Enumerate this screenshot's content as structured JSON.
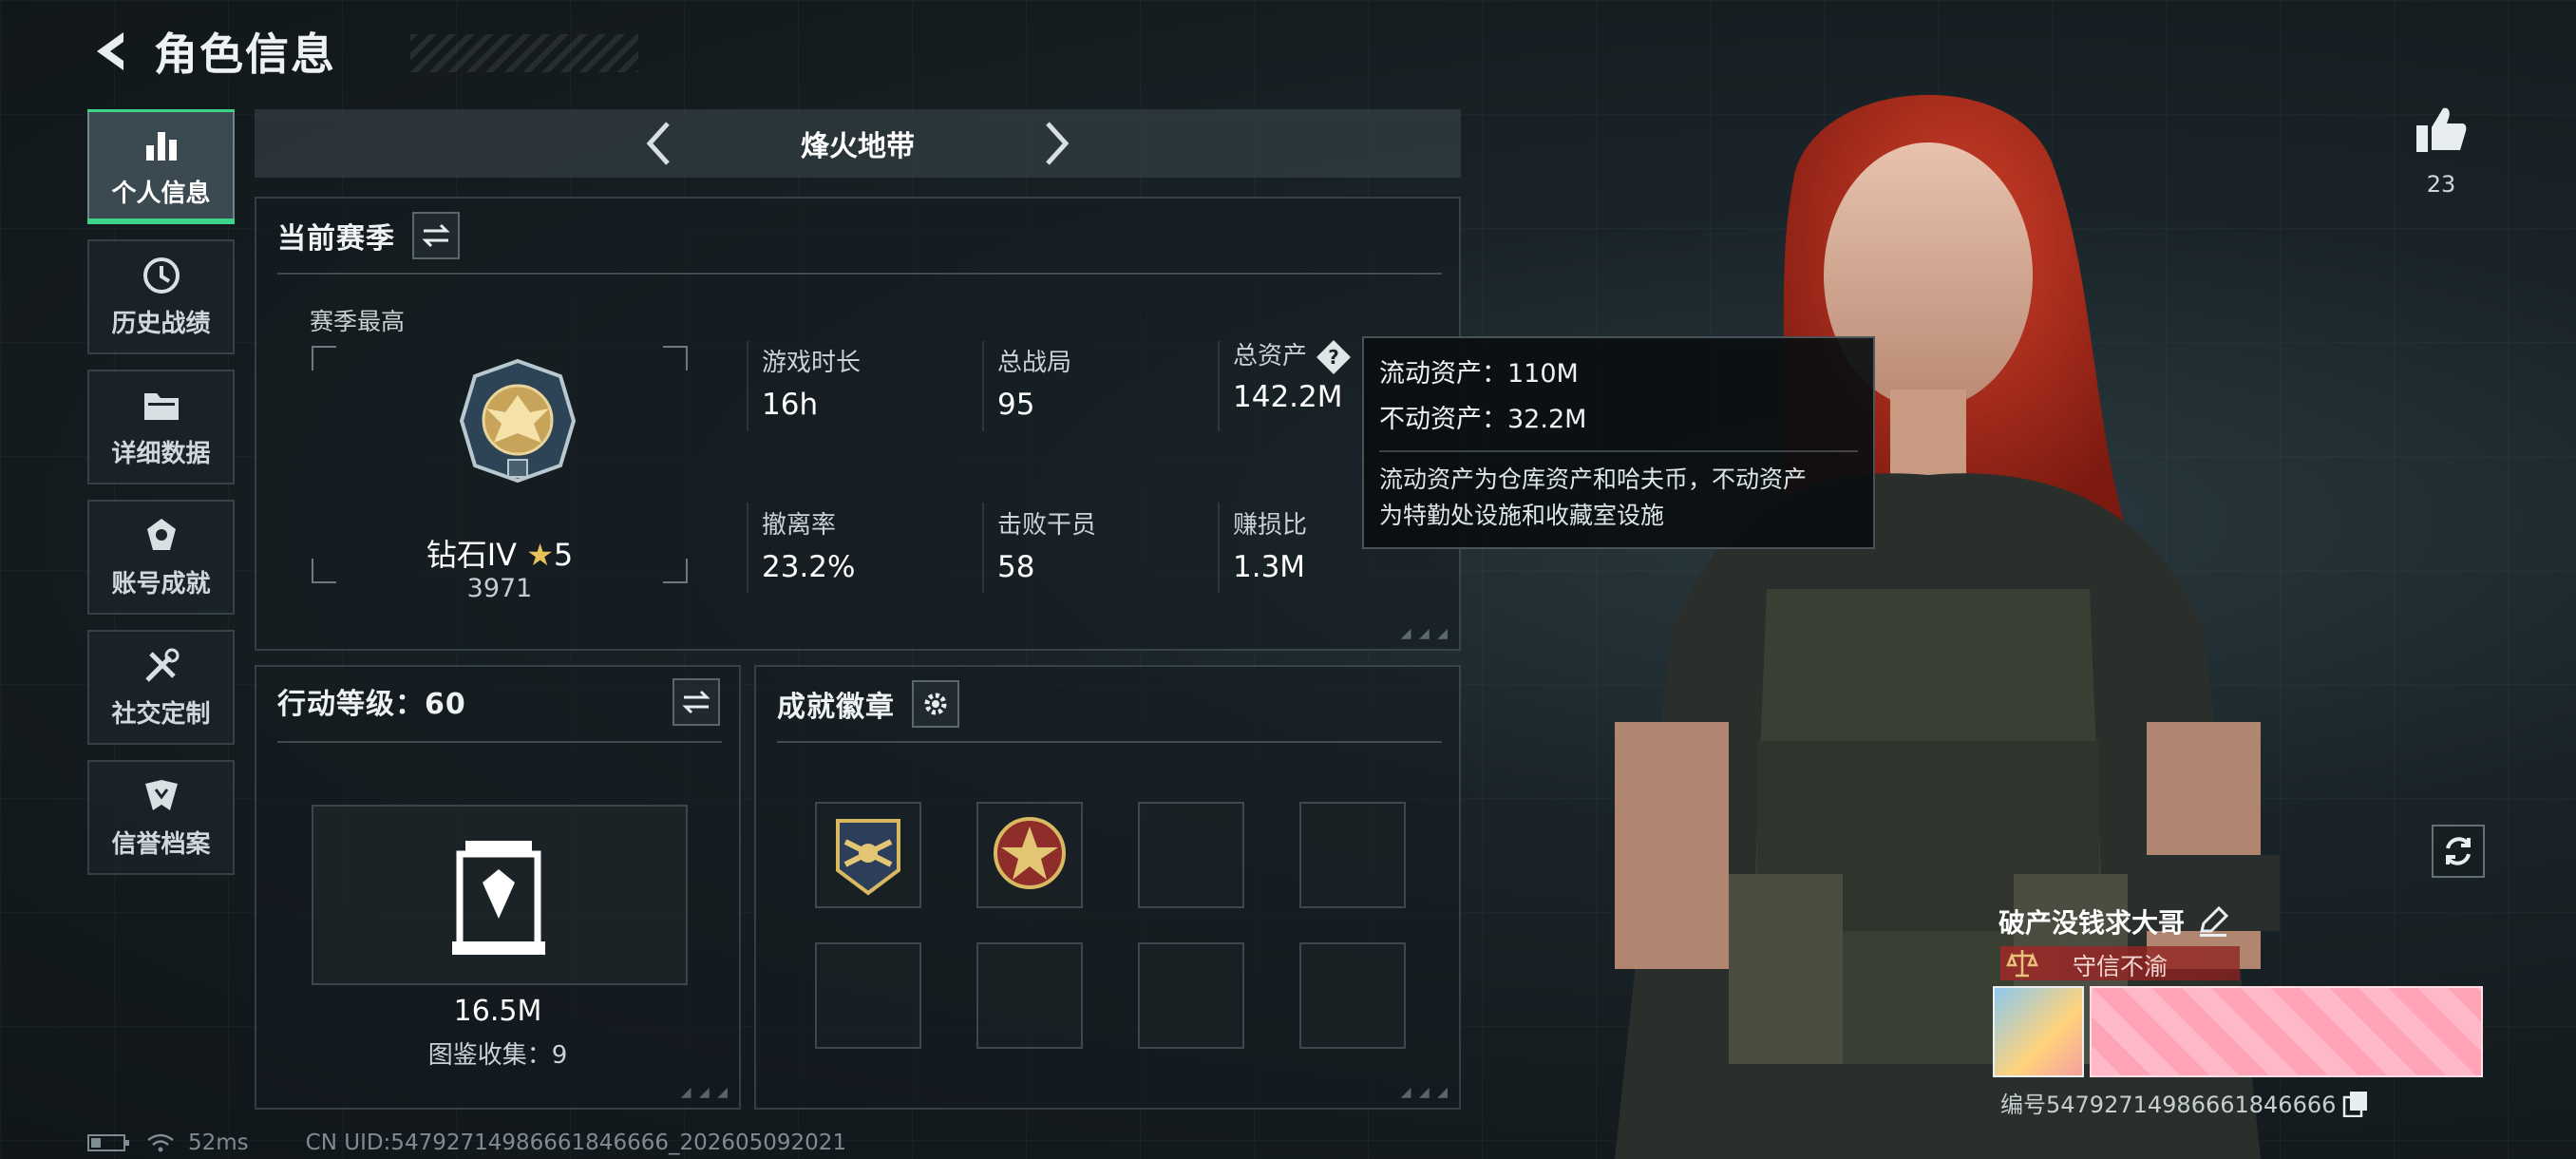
{
  "header": {
    "title": "角色信息"
  },
  "sidebar": {
    "items": [
      {
        "label": "个人信息",
        "icon": "bar-chart-icon",
        "active": true
      },
      {
        "label": "历史战绩",
        "icon": "history-icon",
        "active": false
      },
      {
        "label": "详细数据",
        "icon": "folder-icon",
        "active": false
      },
      {
        "label": "账号成就",
        "icon": "achievement-icon",
        "active": false
      },
      {
        "label": "社交定制",
        "icon": "tools-icon",
        "active": false
      },
      {
        "label": "信誉档案",
        "icon": "shield-icon",
        "active": false
      }
    ]
  },
  "mode": {
    "title": "烽火地带"
  },
  "season": {
    "title": "当前赛季",
    "best_label": "赛季最高",
    "rank_name": "钻石IV",
    "rank_stars": "5",
    "rank_score": "3971",
    "stats": [
      {
        "label": "游戏时长",
        "value": "16h"
      },
      {
        "label": "总战局",
        "value": "95"
      },
      {
        "label": "总资产",
        "value": "142.2M"
      },
      {
        "label": "撤离率",
        "value": "23.2%"
      },
      {
        "label": "击败干员",
        "value": "58"
      },
      {
        "label": "赚损比",
        "value": "1.3M"
      }
    ]
  },
  "tooltip": {
    "liquid": "流动资产：110M",
    "fixed": "不动资产：32.2M",
    "desc_line1": "流动资产为仓库资产和哈夫币，不动资产",
    "desc_line2": "为特勤处设施和收藏室设施"
  },
  "level": {
    "title": "行动等级：60",
    "value": "16.5M",
    "collection": "图鉴收集：9"
  },
  "badges": {
    "title": "成就徽章",
    "slots_filled": 2,
    "slots_total": 8
  },
  "profile": {
    "likes": "23",
    "player_name": "破产没钱求大哥",
    "honor": "守信不渝",
    "uid_label": "编号5479271498666184666​6"
  },
  "status": {
    "ping": "52ms",
    "uid": "CN UID:5479271498666184666​6_202605092021"
  },
  "colors": {
    "accent": "#3fd38a",
    "honor": "#a02828",
    "banner": "#ffb8c8"
  }
}
